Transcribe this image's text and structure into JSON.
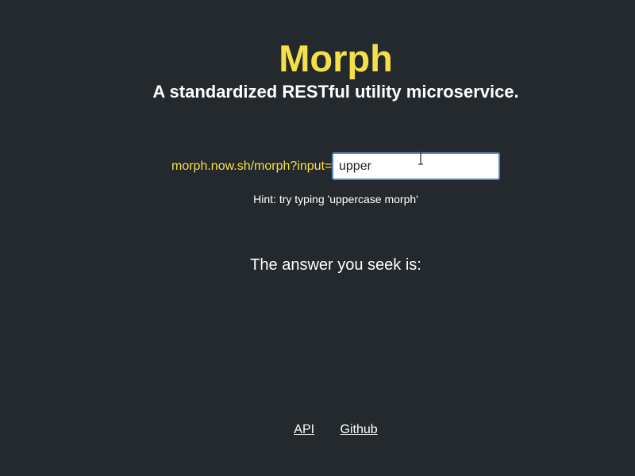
{
  "header": {
    "title": "Morph",
    "subtitle": "A standardized RESTful utility microservice."
  },
  "form": {
    "url_prefix": "morph.now.sh/morph?input=",
    "input_value": "upper",
    "hint": "Hint: try typing 'uppercase morph'"
  },
  "result": {
    "label": "The answer you seek is:"
  },
  "footer": {
    "links": [
      {
        "label": "API"
      },
      {
        "label": "Github"
      }
    ]
  },
  "colors": {
    "background": "#23292d",
    "accent": "#f6e04a",
    "text": "#ffffff",
    "input_border": "#5b87c9"
  }
}
